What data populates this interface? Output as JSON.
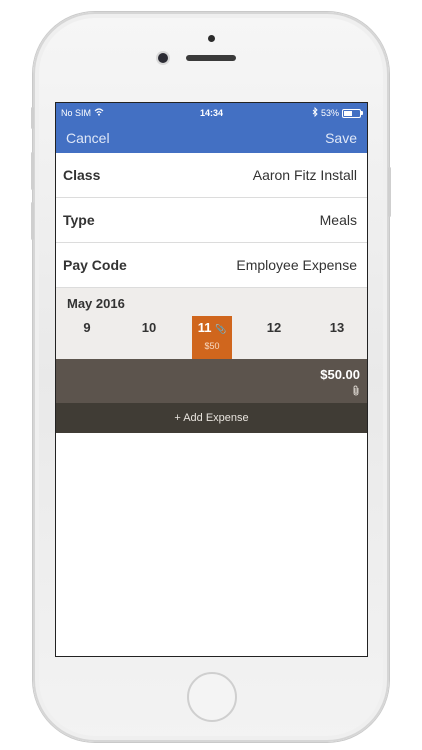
{
  "status_bar": {
    "carrier": "No SIM",
    "time": "14:34",
    "battery_text": "53%",
    "battery_level": 0.53
  },
  "nav": {
    "cancel_label": "Cancel",
    "save_label": "Save"
  },
  "form": {
    "rows": [
      {
        "label": "Class",
        "value": "Aaron Fitz Install"
      },
      {
        "label": "Type",
        "value": "Meals"
      },
      {
        "label": "Pay Code",
        "value": "Employee Expense"
      }
    ]
  },
  "calendar": {
    "month_label": "May 2016",
    "days": [
      {
        "num": "9"
      },
      {
        "num": "10"
      },
      {
        "num": "11",
        "amount": "$50",
        "selected": true
      },
      {
        "num": "12"
      },
      {
        "num": "13"
      }
    ]
  },
  "expense": {
    "amount": "$50.00"
  },
  "add_expense_label": "+ Add Expense",
  "colors": {
    "nav_blue": "#4370c3",
    "selected_day": "#d0661d",
    "expense_row": "#5c544d",
    "add_bar": "#403c35"
  },
  "icons": {
    "wifi": "wifi-icon",
    "bluetooth": "bluetooth-icon",
    "battery": "battery-icon",
    "attachment": "paperclip-icon"
  }
}
